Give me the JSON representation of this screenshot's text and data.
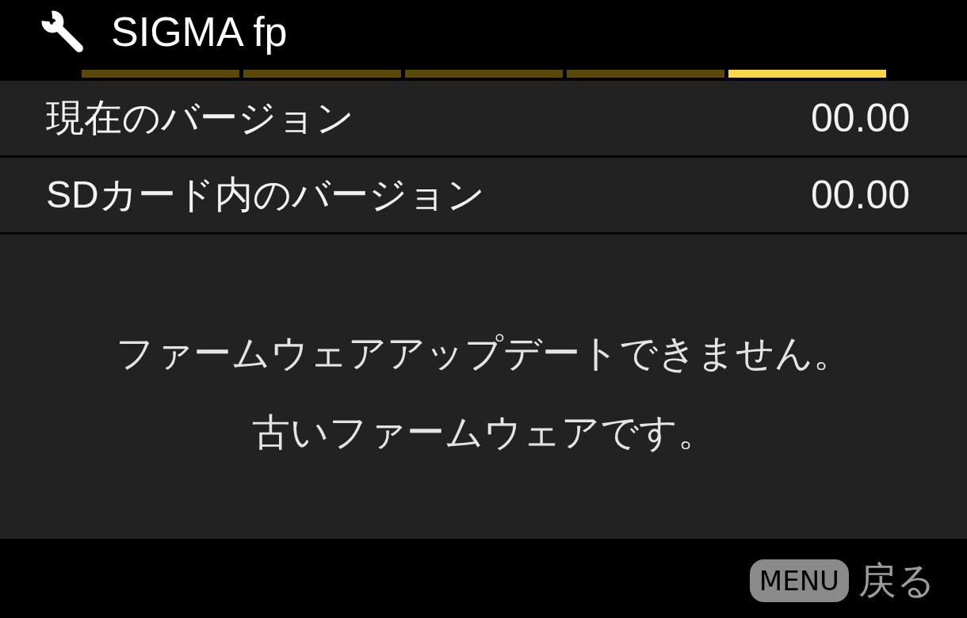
{
  "header": {
    "title": "SIGMA fp"
  },
  "tabs": [
    {
      "selected": false
    },
    {
      "selected": false
    },
    {
      "selected": false
    },
    {
      "selected": false
    },
    {
      "selected": true
    }
  ],
  "rows": [
    {
      "label": "現在のバージョン",
      "value": "00.00"
    },
    {
      "label": "SDカード内のバージョン",
      "value": "00.00"
    }
  ],
  "message": [
    "ファームウェアアップデートできません。",
    "古いファームウェアです。"
  ],
  "footer": {
    "key": "MENU",
    "action": "戻る"
  }
}
